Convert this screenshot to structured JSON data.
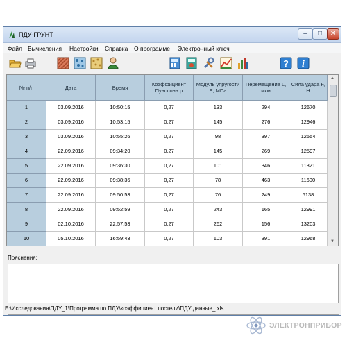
{
  "window": {
    "title": "ПДУ-ГРУНТ"
  },
  "menu": [
    "Файл",
    "Вычисления",
    "Настройки",
    "Справка",
    "О программе",
    "Электронный ключ"
  ],
  "toolbar": {
    "icons": [
      "open-folder-icon",
      "save-print-icon",
      "texture-red-icon",
      "texture-blue-icon",
      "texture-gold-icon",
      "user-icon",
      "calc-blue-icon",
      "calc-teal-icon",
      "tools-icon",
      "chart-icon",
      "bar-chart-icon",
      "help-icon",
      "info-icon"
    ],
    "help_label": "?",
    "info_label": "i"
  },
  "table": {
    "headers": [
      "№ п/п",
      "Дата",
      "Время",
      "Коэффициент Пуассона μ",
      "Модуль упругости E, МПа",
      "Перемещение L, мкм",
      "Сила удара F, Н"
    ],
    "rows": [
      [
        "1",
        "03.09.2016",
        "10:50:15",
        "0,27",
        "133",
        "294",
        "12670"
      ],
      [
        "2",
        "03.09.2016",
        "10:53:15",
        "0,27",
        "145",
        "276",
        "12946"
      ],
      [
        "3",
        "03.09.2016",
        "10:55:26",
        "0,27",
        "98",
        "397",
        "12554"
      ],
      [
        "4",
        "22.09.2016",
        "09:34:20",
        "0,27",
        "145",
        "269",
        "12597"
      ],
      [
        "5",
        "22.09.2016",
        "09:36:30",
        "0,27",
        "101",
        "346",
        "11321"
      ],
      [
        "6",
        "22.09.2016",
        "09:38:36",
        "0,27",
        "78",
        "463",
        "11600"
      ],
      [
        "7",
        "22.09.2016",
        "09:50:53",
        "0,27",
        "76",
        "249",
        "6138"
      ],
      [
        "8",
        "22.09.2016",
        "09:52:59",
        "0,27",
        "243",
        "165",
        "12991"
      ],
      [
        "9",
        "02.10.2016",
        "22:57:53",
        "0,27",
        "262",
        "156",
        "13203"
      ],
      [
        "10",
        "05.10.2016",
        "16:59:43",
        "0,27",
        "103",
        "391",
        "12968"
      ]
    ]
  },
  "notes": {
    "label": "Пояснения:",
    "value": ""
  },
  "status": {
    "path": "E:\\Исследования\\ПДУ_1\\Программа по ПДУ\\коэффициент постели\\ПДУ данные_.xls"
  },
  "brand": {
    "name": "ЭЛЕКТРОНПРИБОР"
  },
  "colors": {
    "header_bg": "#b8cede",
    "title_bg": "#c3d5ee",
    "close_btn": "#c8452c",
    "brand_text": "#b9b9b9"
  }
}
